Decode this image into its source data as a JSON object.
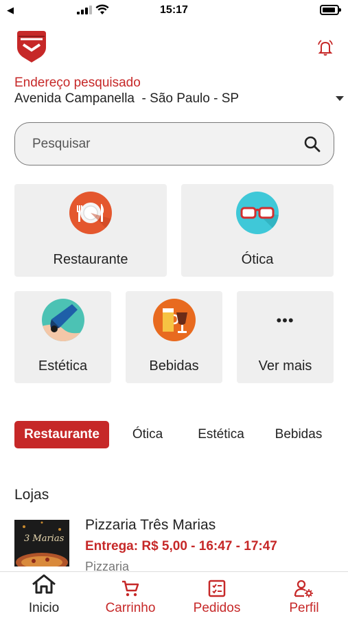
{
  "status_bar": {
    "time": "15:17",
    "back": "◀"
  },
  "colors": {
    "brand": "#c62828",
    "tile_bg": "#efefef"
  },
  "address": {
    "label": "Endereço pesquisado",
    "value": "Avenida Campanella  - São Paulo - SP"
  },
  "search": {
    "placeholder": "Pesquisar"
  },
  "categories": [
    {
      "label": "Restaurante",
      "icon": "plate-cutlery-icon"
    },
    {
      "label": "Ótica",
      "icon": "glasses-icon"
    },
    {
      "label": "Estética",
      "icon": "beauty-pen-icon"
    },
    {
      "label": "Bebidas",
      "icon": "beer-icon"
    },
    {
      "label": "Ver mais",
      "icon": "more-dots-icon"
    }
  ],
  "more_dots": "•••",
  "chips": [
    {
      "label": "Restaurante",
      "active": true
    },
    {
      "label": "Ótica",
      "active": false
    },
    {
      "label": "Estética",
      "active": false
    },
    {
      "label": "Bebidas",
      "active": false
    }
  ],
  "stores": {
    "title": "Lojas",
    "items": [
      {
        "name": "Pizzaria Três Marias",
        "delivery": "Entrega: R$ 5,00 - 16:47 - 17:47",
        "category": "Pizzaria",
        "thumb_text": "3 Marias"
      }
    ]
  },
  "bottom_nav": [
    {
      "label": "Inicio",
      "icon": "home-icon"
    },
    {
      "label": "Carrinho",
      "icon": "cart-icon"
    },
    {
      "label": "Pedidos",
      "icon": "orders-icon"
    },
    {
      "label": "Perfil",
      "icon": "profile-settings-icon"
    }
  ]
}
